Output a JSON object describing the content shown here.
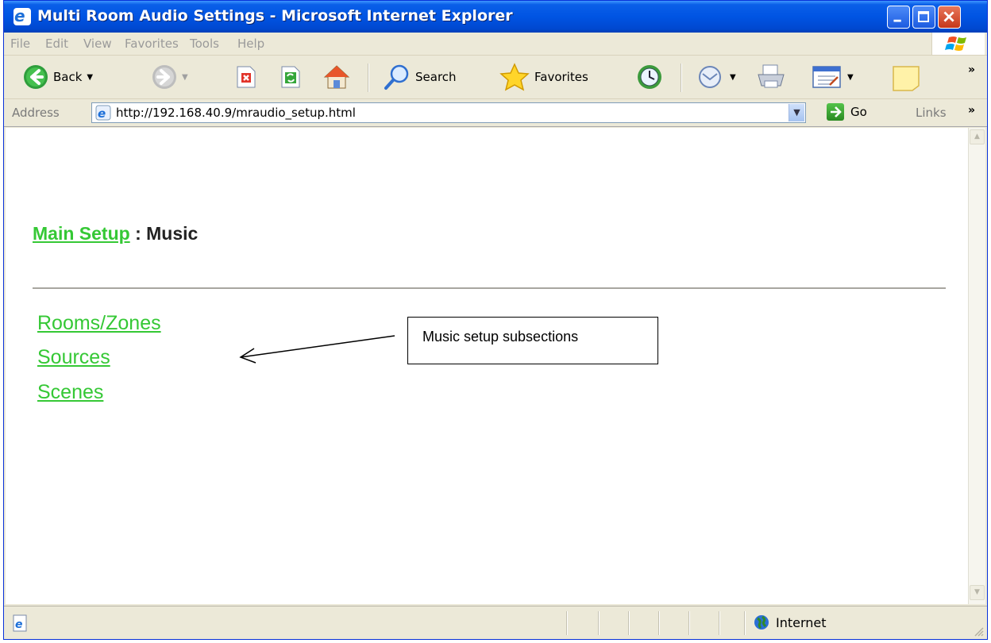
{
  "window": {
    "title": "Multi Room Audio Settings - Microsoft Internet Explorer"
  },
  "menu": {
    "items": [
      "File",
      "Edit",
      "View",
      "Favorites",
      "Tools",
      "Help"
    ]
  },
  "toolbar": {
    "back_label": "Back",
    "search_label": "Search",
    "favorites_label": "Favorites"
  },
  "address": {
    "label": "Address",
    "url": "http://192.168.40.9/mraudio_setup.html",
    "go_label": "Go",
    "links_label": "Links"
  },
  "page": {
    "breadcrumb_link": "Main Setup",
    "breadcrumb_separator": ":",
    "breadcrumb_current": "Music",
    "links": [
      "Rooms/Zones",
      "Sources",
      "Scenes"
    ],
    "callout_text": "Music setup subsections",
    "link_color": "#35c835"
  },
  "status": {
    "zone_label": "Internet"
  }
}
